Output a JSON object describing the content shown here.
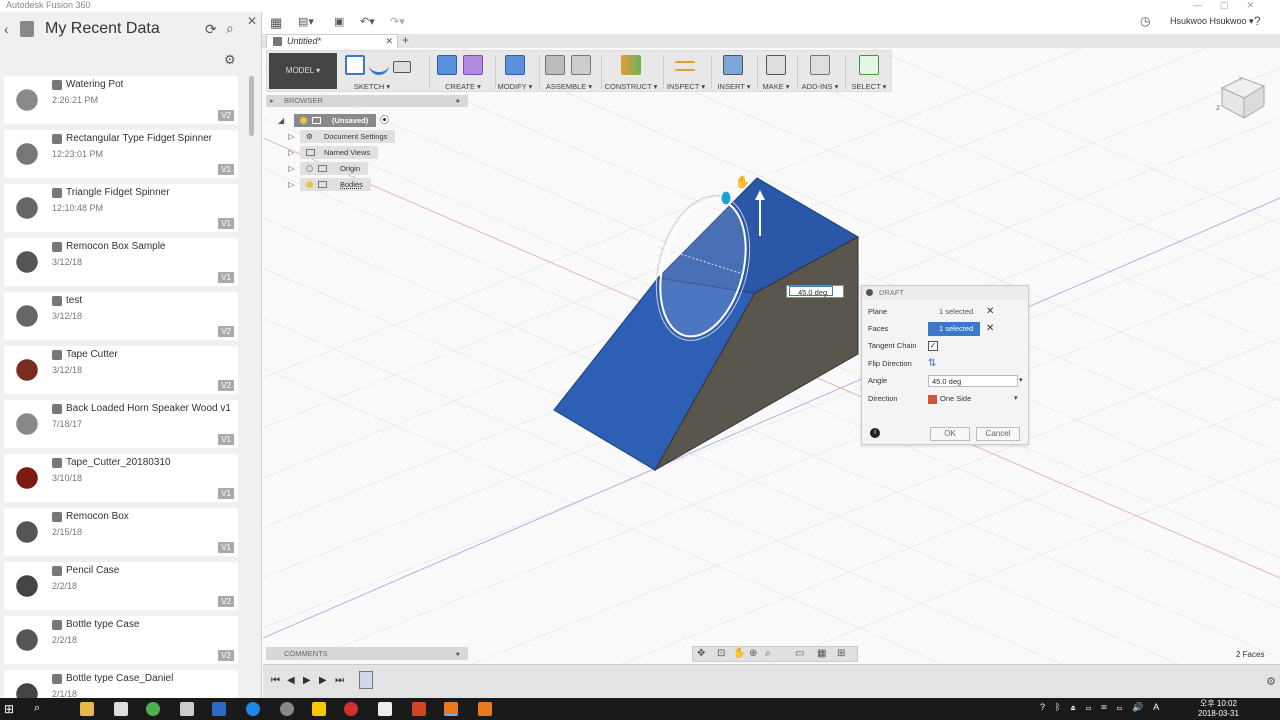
{
  "window": {
    "title": "Autodesk Fusion 360"
  },
  "data_panel": {
    "title": "My Recent Data",
    "items": [
      {
        "name": "Watering Pot",
        "date": "2:26:21 PM",
        "version": "V2"
      },
      {
        "name": "Rectangular Type Fidget Spinner",
        "date": "12:23:01 PM",
        "version": "V1"
      },
      {
        "name": "Triangle Fidget Spinner",
        "date": "12:10:48 PM",
        "version": "V1"
      },
      {
        "name": "Remocon Box Sample",
        "date": "3/12/18",
        "version": "V1"
      },
      {
        "name": "test",
        "date": "3/12/18",
        "version": "V2"
      },
      {
        "name": "Tape Cutter",
        "date": "3/12/18",
        "version": "V2"
      },
      {
        "name": "Back Loaded Horn Speaker Wood v1",
        "date": "7/18/17",
        "version": "V1"
      },
      {
        "name": "Tape_Cutter_20180310",
        "date": "3/10/18",
        "version": "V1"
      },
      {
        "name": "Remocon Box",
        "date": "2/15/18",
        "version": "V1"
      },
      {
        "name": "Pencil Case",
        "date": "2/2/18",
        "version": "V2"
      },
      {
        "name": "Bottle type Case",
        "date": "2/2/18",
        "version": "V2"
      },
      {
        "name": "Bottle type Case_Daniel",
        "date": "2/1/18",
        "version": ""
      }
    ]
  },
  "user": {
    "name": "Hsukwoo Hsukwoo ▾"
  },
  "document_tab": {
    "label": "Untitled*"
  },
  "toolbar": {
    "mode": "MODEL ▾",
    "groups": [
      "SKETCH ▾",
      "CREATE ▾",
      "MODIFY ▾",
      "ASSEMBLE ▾",
      "CONSTRUCT ▾",
      "INSPECT ▾",
      "INSERT ▾",
      "MAKE ▾",
      "ADD-INS ▾",
      "SELECT ▾"
    ]
  },
  "browser": {
    "title": "BROWSER",
    "nodes": [
      {
        "label": "(Unsaved)"
      },
      {
        "label": "Document Settings"
      },
      {
        "label": "Named Views"
      },
      {
        "label": "Origin"
      },
      {
        "label": "Bodies"
      }
    ]
  },
  "canvas": {
    "angle_input": "45.0 deg",
    "face_count": "2 Faces"
  },
  "draft_dialog": {
    "title": "DRAFT",
    "plane_label": "Plane",
    "plane_value": "1 selected",
    "faces_label": "Faces",
    "faces_value": "1 selected",
    "tangent_label": "Tangent Chain",
    "tangent_checked": true,
    "flip_label": "Flip Direction",
    "angle_label": "Angle",
    "angle_value": "45.0 deg",
    "direction_label": "Direction",
    "direction_value": "One Side",
    "ok_label": "OK",
    "cancel_label": "Cancel"
  },
  "comments": {
    "title": "COMMENTS"
  },
  "taskbar": {
    "time": "오후 10:02",
    "date": "2018-03-31"
  },
  "colors": {
    "accent": "#3c78c8",
    "body_blue": "#2d5fb5",
    "body_dark": "#5a554d"
  }
}
